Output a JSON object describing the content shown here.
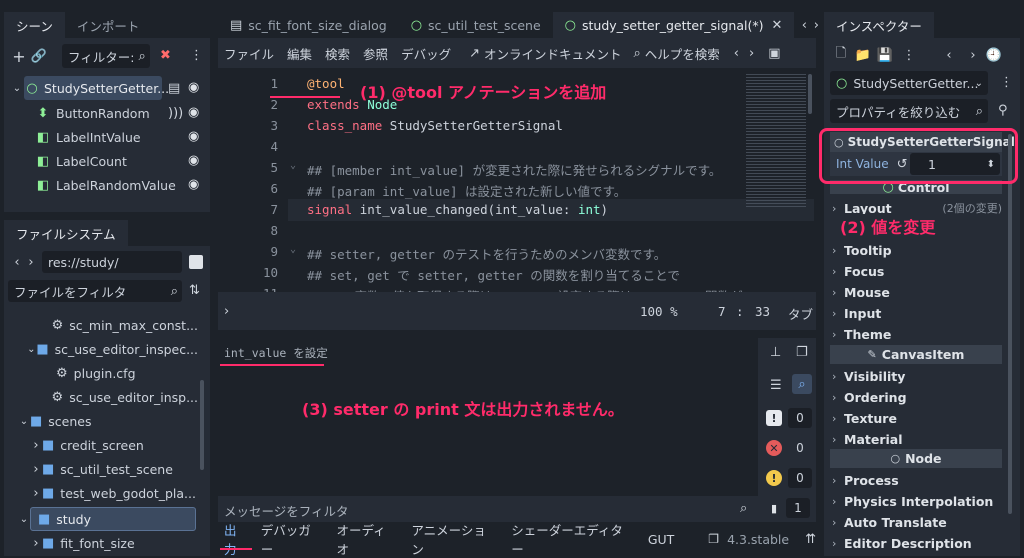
{
  "scene_dock": {
    "tabs": [
      "シーン",
      "インポート"
    ],
    "filter_placeholder": "フィルター:",
    "tree": [
      {
        "label": "StudySetterGetter...",
        "icon": "node-icon"
      },
      {
        "label": "ButtonRandom",
        "icon": "button-icon"
      },
      {
        "label": "LabelIntValue",
        "icon": "label-icon"
      },
      {
        "label": "LabelCount",
        "icon": "label-icon"
      },
      {
        "label": "LabelRandomValue",
        "icon": "label-icon"
      }
    ]
  },
  "filesystem": {
    "tab": "ファイルシステム",
    "path": "res://study/",
    "filter_placeholder": "ファイルをフィルタ",
    "items": [
      "sc_min_max_const...",
      "sc_use_editor_inspec...",
      "plugin.cfg",
      "sc_use_editor_insp...",
      "scenes",
      "credit_screen",
      "sc_util_test_scene",
      "test_web_godot_pla...",
      "study",
      "fit_font_size"
    ]
  },
  "editor_tabs": [
    "sc_fit_font_size_dialog",
    "sc_util_test_scene",
    "study_setter_getter_signal(*)"
  ],
  "menu": [
    "ファイル",
    "編集",
    "検索",
    "参照",
    "デバッグ",
    "オンラインドキュメント",
    "ヘルプを検索"
  ],
  "code_lines": [
    {
      "n": "1",
      "parts": [
        [
          "an",
          "@tool"
        ]
      ]
    },
    {
      "n": "2",
      "parts": [
        [
          "kw",
          "extends "
        ],
        [
          "ty",
          "Node"
        ]
      ]
    },
    {
      "n": "3",
      "parts": [
        [
          "kw",
          "class_name "
        ],
        [
          "pl",
          "StudySetterGetterSignal"
        ]
      ]
    },
    {
      "n": "4",
      "parts": []
    },
    {
      "n": "5",
      "parts": [
        [
          "cm",
          "## [member int_value] が変更された際に発せられるシグナルです。"
        ]
      ]
    },
    {
      "n": "6",
      "parts": [
        [
          "cm",
          "## [param int_value] は設定された新しい値です。"
        ]
      ]
    },
    {
      "n": "7",
      "parts": [
        [
          "kw",
          "signal "
        ],
        [
          "pl",
          "int_value_changed(int_value: "
        ],
        [
          "ty",
          "int"
        ],
        [
          "pl",
          ")"
        ]
      ]
    },
    {
      "n": "8",
      "parts": []
    },
    {
      "n": "9",
      "parts": [
        [
          "cm",
          "## setter, getter のテストを行うためのメンバ変数です。"
        ]
      ]
    },
    {
      "n": "10",
      "parts": [
        [
          "cm",
          "## set, get で setter, getter の関数を割り当てることで"
        ]
      ]
    },
    {
      "n": "11",
      "parts": [
        [
          "cm",
          "## この変数の値を取得する際は getter、設定する際は setter の関数が"
        ]
      ]
    }
  ],
  "status": {
    "zoom": "100 %",
    "line": "7",
    "col": "33",
    "indent": "タブ"
  },
  "output": {
    "text": "int_value を設定",
    "filter_placeholder": "メッセージをフィルタ",
    "counts": [
      "0",
      "0",
      "0",
      "1"
    ]
  },
  "bottom_tabs": [
    "出力",
    "デバッガー",
    "オーディオ",
    "アニメーション",
    "シェーダーエディター",
    "GUT"
  ],
  "version": "4.3.stable",
  "inspector": {
    "tab": "インスペクター",
    "node": "StudySetterGetter...",
    "filter_placeholder": "プロパティを絞り込む",
    "script_class": "StudySetterGetterSignal",
    "prop_label": "Int Value",
    "prop_value": "1",
    "control_section": "Control",
    "layout": "Layout",
    "layout_hint": "(2個の変更)",
    "items_a": [
      "Tooltip",
      "Focus",
      "Mouse",
      "Input",
      "Theme"
    ],
    "canvas_section": "CanvasItem",
    "items_b": [
      "Visibility",
      "Ordering",
      "Texture",
      "Material"
    ],
    "node_section": "Node",
    "items_c": [
      "Process",
      "Physics Interpolation",
      "Auto Translate",
      "Editor Description"
    ]
  },
  "annotations": [
    "(1) @tool アノテーションを追加",
    "(2) 値を変更",
    "(3) setter の print 文は出力されません。"
  ],
  "colors": {
    "accent": "#ff2b6a",
    "bg": "#262c36"
  }
}
